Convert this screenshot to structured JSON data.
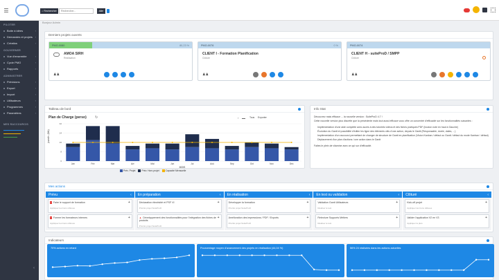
{
  "topbar": {
    "search_scope": "Rechercher",
    "search_placeholder": "Rechercher...",
    "ok_label": "Aller"
  },
  "breadcrumb": "Bonjour Admin",
  "sidebar": {
    "sections": [
      {
        "title": "PILOTER",
        "items": [
          {
            "label": "Boite à idées"
          },
          {
            "label": "Demandes et projets"
          },
          {
            "label": "Créatios"
          }
        ]
      },
      {
        "title": "GOUVERNER",
        "items": [
          {
            "label": "Vue d'ensemble"
          },
          {
            "label": "Cycle PMO"
          },
          {
            "label": "Rapports"
          }
        ]
      },
      {
        "title": "ADMINISTRER",
        "items": [
          {
            "label": "Prévisions"
          },
          {
            "label": "Export"
          },
          {
            "label": "Import"
          },
          {
            "label": "Utilisateurs"
          },
          {
            "label": "Programmes"
          },
          {
            "label": "Paramètres"
          }
        ]
      }
    ],
    "extra_title": "MES RACCOURCIS"
  },
  "projects": {
    "title": "Derniers projets ouverts",
    "cards": [
      {
        "code": "PMO-0080",
        "pct": "80,23 %",
        "name": "AMOA SIRH",
        "sub": "Réalisation",
        "bar": 0.3
      },
      {
        "code": "PMO-0076",
        "pct": "0 %",
        "name": "CLIENT I - Formation Planification",
        "sub": "Clôture",
        "bar": 0
      },
      {
        "code": "PMO-0074",
        "pct": "",
        "name": "CLIENT H - suiteProD / SMPP",
        "sub": "Clôture",
        "bar": 0
      }
    ]
  },
  "dashboard": {
    "title": "Tableau de bord",
    "chart_title": "Plan de Charge (perso)",
    "year": "Tous",
    "scope": "Exporter"
  },
  "chart_data": {
    "type": "bar",
    "categories": [
      "Jan",
      "Fév",
      "Mar",
      "Avr",
      "Mai",
      "Jun",
      "Jui",
      "Aoû",
      "Sep",
      "Oct",
      "Nov",
      "Déc"
    ],
    "series": [
      {
        "name": "Prév. Projet",
        "values": [
          12,
          18,
          15,
          10,
          11,
          10,
          12,
          11,
          10,
          12,
          11,
          10
        ],
        "color": "#3557a8"
      },
      {
        "name": "Prév. Hors projet",
        "values": [
          3,
          12,
          15,
          3,
          4,
          5,
          11,
          8,
          3,
          4,
          4,
          2
        ],
        "color": "#1f2d4d"
      },
      {
        "name": "Capacité Mensuelle",
        "values": [
          16,
          16,
          16,
          16,
          16,
          16,
          16,
          16,
          16,
          16,
          16,
          16
        ],
        "color": "#f4b400"
      }
    ],
    "ylim": [
      0,
      32
    ],
    "xlabel": "MOIS",
    "ylabel": "jours/h. (Mh)"
  },
  "info": {
    "title": "Info Stat",
    "lines": [
      "Découvrez mais efficace ... la nouvelle version : SuiteProD 4.7 !",
      "Cette nouvelle version plus discrète que la précédente mais tout aussi efficace vous offre un concentré d'efficacité sur les fonctionnalités suivantes :",
      "Implémentation d'une aide complète avec accès à des tutoriels vidéos et des fiches pratiques PDF (bouton note en haut à Gauche)",
      "Évolution du Gantt et possibilité d'éditer les ligne des éléments clés d'une action, depuis le Gantt (Responsable, durée, dates, ...)",
      "Implémentation d'un raccourci permettant de changer de structure de Gantt en planification (Vision Kanban / défaut ou Gantt / défaut du mode Kanban / défaut)",
      "Déplacement d'un plan d'actions / une action dans le Gantt",
      "Faites le plein de vitamine avec ce qui sur d'efficacité."
    ]
  },
  "actions": {
    "title": "Mes actions",
    "lanes": [
      {
        "label": "Prévu",
        "tasks": [
          {
            "t": "Faire le support de formation",
            "s": "Appliquer les bons réflexes"
          },
          {
            "t": "Former les formateurs internes",
            "s": "Appliquer les bons réflexes"
          }
        ]
      },
      {
        "label": "En préparation",
        "tasks": [
          {
            "t": "Déclaration électricité et PSF VI",
            "s": "Priorité projet SuiteProD"
          },
          {
            "t": "Développement des fonctionnalités pour l'intégration des fiches de produits",
            "s": "Priorité projet SuiteProD"
          }
        ]
      },
      {
        "label": "En réalisation",
        "tasks": [
          {
            "t": "Développer la formation",
            "s": "Priorité projet SuiteProD"
          },
          {
            "t": "Amélioration des impressions / PDF / Exports",
            "s": "Priorité projet SuiteProD"
          }
        ]
      },
      {
        "label": "En test ou validation",
        "tasks": [
          {
            "t": "Validation Gantt Utilisateurs",
            "s": "Réaliser le test"
          },
          {
            "t": "Relecture Supports Métiers",
            "s": "Réaliser le test"
          }
        ]
      },
      {
        "label": "Clôturé",
        "tasks": [
          {
            "t": "Kick-off projet",
            "s": "Appliquer les bons réflexes"
          },
          {
            "t": "Valider l'application V2 en V3",
            "s": "Appliquer le plan"
          }
        ]
      }
    ]
  },
  "indicators": {
    "title": "Indicateurs",
    "cards": [
      {
        "label": "70% actions en retard",
        "values": [
          20,
          22,
          25,
          24,
          30,
          34,
          36,
          44,
          48,
          50,
          53,
          60
        ]
      },
      {
        "label": "Pourcentage moyen d'avancement des projets en réalisation (44,04 %)",
        "values": [
          60,
          60,
          60,
          60,
          60,
          60,
          60,
          60,
          60,
          12,
          10,
          10
        ]
      },
      {
        "label": "56% 24 réalisées dans les actions actuelles",
        "values": [
          10,
          10,
          10,
          10,
          10,
          10,
          10,
          10,
          10,
          10,
          45,
          45
        ]
      }
    ]
  }
}
